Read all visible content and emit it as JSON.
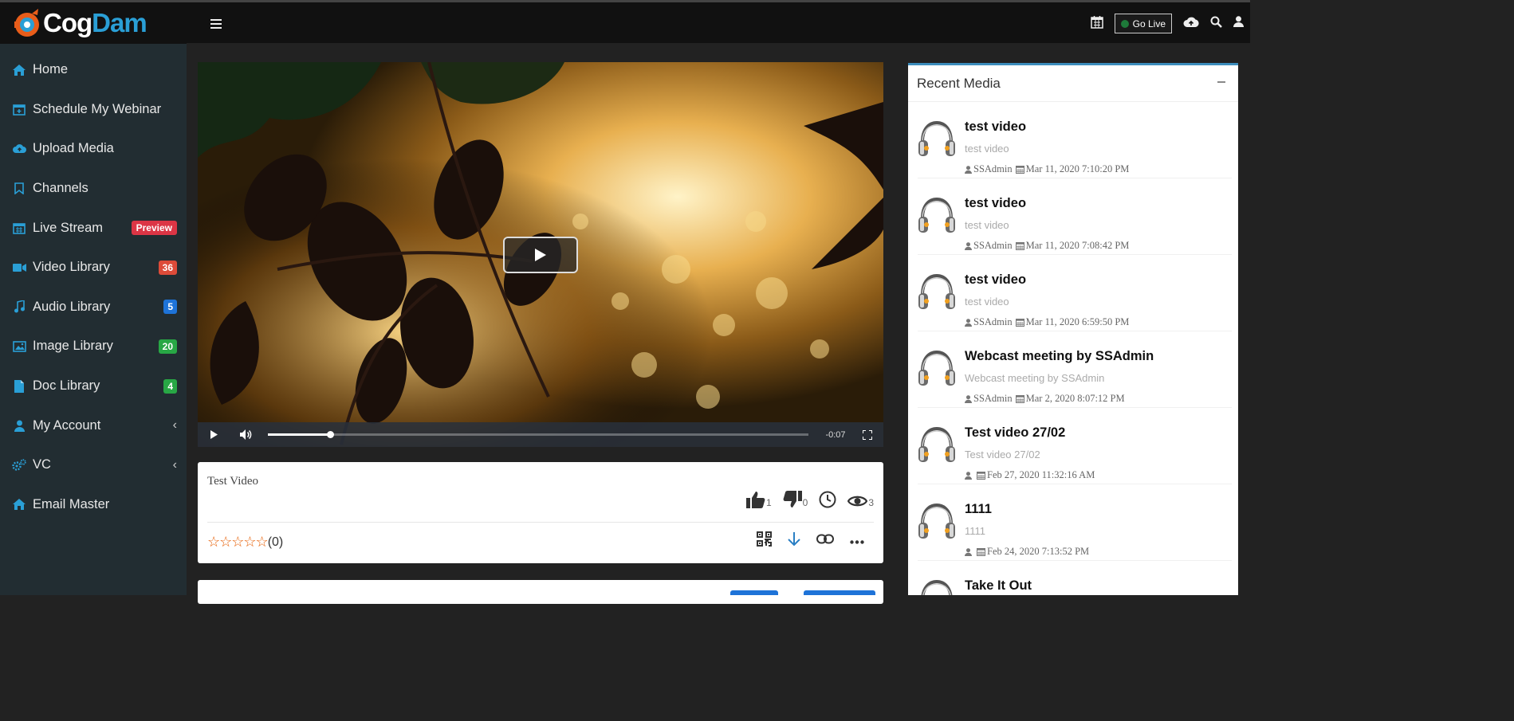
{
  "brand": {
    "part1": "Cog",
    "part2": "Dam"
  },
  "sidebar": {
    "items": [
      {
        "label": "Home",
        "icon": "home-icon"
      },
      {
        "label": "Schedule My Webinar",
        "icon": "calendar-plus-icon"
      },
      {
        "label": "Upload Media",
        "icon": "cloud-upload-icon"
      },
      {
        "label": "Channels",
        "icon": "bookmark-icon"
      },
      {
        "label": "Live Stream",
        "icon": "calendar-icon",
        "badge": "Preview"
      },
      {
        "label": "Video Library",
        "icon": "video-camera-icon",
        "badge": "36"
      },
      {
        "label": "Audio Library",
        "icon": "music-note-icon",
        "badge": "5"
      },
      {
        "label": "Image Library",
        "icon": "image-icon",
        "badge": "20"
      },
      {
        "label": "Doc Library",
        "icon": "document-icon",
        "badge": "4"
      },
      {
        "label": "My Account",
        "icon": "user-icon",
        "chevron": "‹"
      },
      {
        "label": "VC",
        "icon": "cogs-icon",
        "chevron": "‹"
      },
      {
        "label": "Email Master",
        "icon": "home-icon"
      }
    ]
  },
  "header": {
    "go_live_label": "Go Live"
  },
  "player": {
    "timer": "-0:07",
    "progress_fraction": 0.115
  },
  "info": {
    "title": "Test Video",
    "likes": "1",
    "dislikes": "0",
    "views": "3",
    "rating_count": "(0)",
    "stars": "☆☆☆☆☆"
  },
  "recent": {
    "title": "Recent Media",
    "items": [
      {
        "title": "test video",
        "subtitle": "test video",
        "author": "SSAdmin",
        "date": "Mar 11, 2020 7:10:20 PM"
      },
      {
        "title": "test video",
        "subtitle": "test video",
        "author": "SSAdmin",
        "date": "Mar 11, 2020 7:08:42 PM"
      },
      {
        "title": "test video",
        "subtitle": "test video",
        "author": "SSAdmin",
        "date": "Mar 11, 2020 6:59:50 PM"
      },
      {
        "title": "Webcast meeting by SSAdmin",
        "subtitle": "Webcast meeting by SSAdmin",
        "author": "SSAdmin",
        "date": "Mar 2, 2020 8:07:12 PM"
      },
      {
        "title": "Test video 27/02",
        "subtitle": "Test video 27/02",
        "author": "",
        "date": "Feb 27, 2020 11:32:16 AM"
      },
      {
        "title": "1111",
        "subtitle": "1111",
        "author": "",
        "date": "Feb 24, 2020 7:13:52 PM"
      },
      {
        "title": "Take It Out",
        "subtitle": "",
        "author": "",
        "date": ""
      }
    ]
  },
  "colors": {
    "accent": "#2a9fd6",
    "sidebar_bg": "#222d32",
    "badge_red": "#dd4b39",
    "badge_blue": "#1e73d8",
    "badge_green": "#28a745",
    "box_top": "#3c8dbc"
  }
}
